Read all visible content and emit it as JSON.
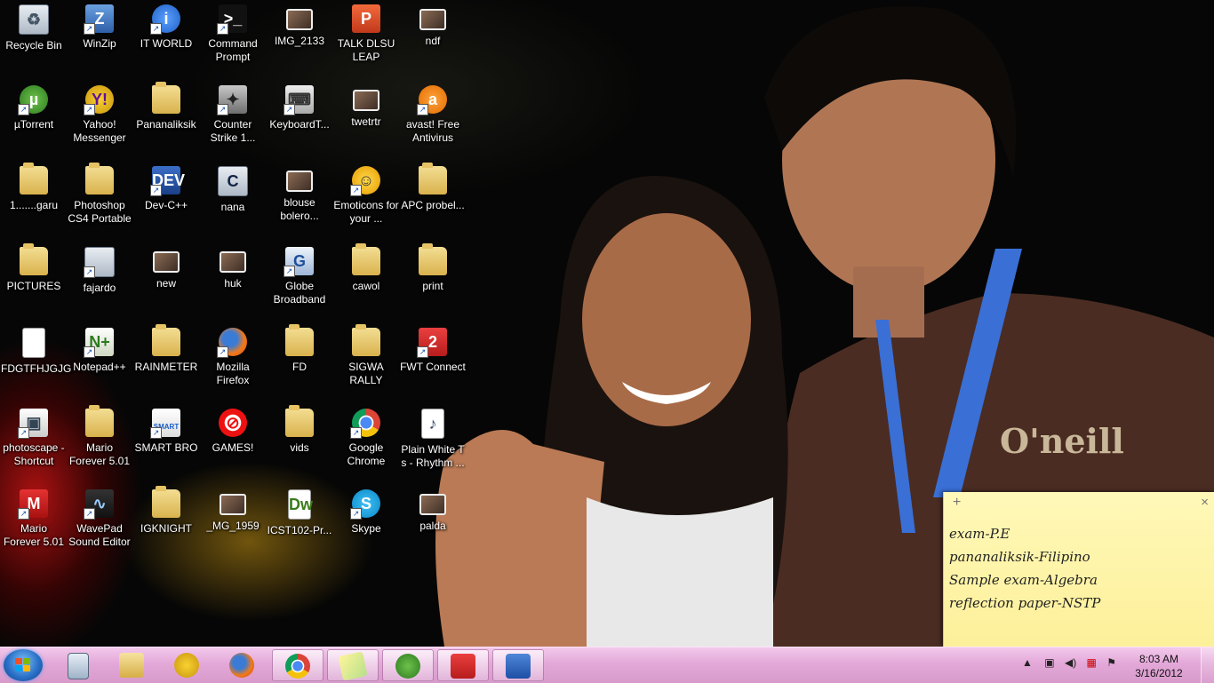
{
  "desktop_icons": [
    {
      "label": "Recycle Bin",
      "icon": "recycle-bin-icon"
    },
    {
      "label": "WinZip",
      "icon": "winzip-icon"
    },
    {
      "label": "IT WORLD",
      "icon": "info-icon"
    },
    {
      "label": "Command Prompt",
      "icon": "command-prompt-icon"
    },
    {
      "label": "IMG_2133",
      "icon": "image-file-icon"
    },
    {
      "label": "TALK DLSU LEAP",
      "icon": "powerpoint-icon"
    },
    {
      "label": "ndf",
      "icon": "image-file-icon"
    },
    {
      "label": "µTorrent",
      "icon": "utorrent-icon"
    },
    {
      "label": "Yahoo! Messenger",
      "icon": "yahoo-messenger-icon"
    },
    {
      "label": "Pananaliksik",
      "icon": "folder-icon"
    },
    {
      "label": "Counter Strike 1...",
      "icon": "counter-strike-icon"
    },
    {
      "label": "KeyboardT...",
      "icon": "keyboard-icon"
    },
    {
      "label": "twetrtr",
      "icon": "image-file-icon"
    },
    {
      "label": "avast! Free Antivirus",
      "icon": "avast-icon"
    },
    {
      "label": "1.......garu",
      "icon": "folder-icon"
    },
    {
      "label": "Photoshop CS4 Portable",
      "icon": "folder-icon"
    },
    {
      "label": "Dev-C++",
      "icon": "dev-cpp-icon"
    },
    {
      "label": "nana",
      "icon": "cpp-file-icon"
    },
    {
      "label": "blouse bolero...",
      "icon": "image-file-icon"
    },
    {
      "label": "Emoticons for your ...",
      "icon": "emoticon-icon"
    },
    {
      "label": "APC probel...",
      "icon": "folder-icon"
    },
    {
      "label": "PICTURES",
      "icon": "folder-icon"
    },
    {
      "label": "fajardo",
      "icon": "window-icon"
    },
    {
      "label": "new",
      "icon": "image-file-icon"
    },
    {
      "label": "huk",
      "icon": "image-file-icon"
    },
    {
      "label": "Globe Broadband",
      "icon": "globe-broadband-icon"
    },
    {
      "label": "cawol",
      "icon": "folder-icon"
    },
    {
      "label": "print",
      "icon": "folder-icon"
    },
    {
      "label": "FDGTFHJGJG",
      "icon": "text-file-icon"
    },
    {
      "label": "Notepad++",
      "icon": "notepad-plus-icon"
    },
    {
      "label": "RAINMETER",
      "icon": "folder-icon"
    },
    {
      "label": "Mozilla Firefox",
      "icon": "firefox-icon"
    },
    {
      "label": "FD",
      "icon": "folder-icon"
    },
    {
      "label": "SIGWA RALLY",
      "icon": "folder-icon"
    },
    {
      "label": "FWT Connect",
      "icon": "fwt-connect-icon"
    },
    {
      "label": "photoscape - Shortcut",
      "icon": "photoscape-icon"
    },
    {
      "label": "Mario Forever 5.01",
      "icon": "folder-icon"
    },
    {
      "label": "SMART BRO",
      "icon": "smart-bro-icon"
    },
    {
      "label": "GAMES!",
      "icon": "no-entry-icon"
    },
    {
      "label": "vids",
      "icon": "folder-icon"
    },
    {
      "label": "Google Chrome",
      "icon": "chrome-icon"
    },
    {
      "label": "Plain White T s - Rhythm ...",
      "icon": "mp3-file-icon"
    },
    {
      "label": "Mario Forever 5.01",
      "icon": "mario-icon"
    },
    {
      "label": "WavePad Sound Editor",
      "icon": "wavepad-icon"
    },
    {
      "label": "IGKNIGHT",
      "icon": "folder-icon"
    },
    {
      "label": "_MG_1959",
      "icon": "image-file-icon"
    },
    {
      "label": "ICST102-Pr...",
      "icon": "dreamweaver-file-icon"
    },
    {
      "label": "Skype",
      "icon": "skype-icon"
    },
    {
      "label": "palda",
      "icon": "image-file-icon"
    }
  ],
  "sticky_note": {
    "lines": [
      "exam-P.E",
      "pananaliksik-Filipino",
      "Sample exam-Algebra",
      "reflection paper-NSTP"
    ],
    "add_label": "+",
    "close_label": "×"
  },
  "taskbar": {
    "pinned": [
      {
        "name": "calculator-icon"
      },
      {
        "name": "windows-explorer-icon"
      },
      {
        "name": "yahoo-messenger-icon"
      },
      {
        "name": "firefox-icon"
      },
      {
        "name": "chrome-icon",
        "active": true
      },
      {
        "name": "sticky-notes-icon",
        "active": true
      },
      {
        "name": "utorrent-icon",
        "active": true
      },
      {
        "name": "fwt-connect-icon",
        "active": true
      },
      {
        "name": "word-icon",
        "active": true
      }
    ],
    "tray_icons": [
      "show-hidden-icons-icon",
      "usb-icon",
      "volume-icon",
      "network-error-icon",
      "action-center-icon"
    ],
    "clock": {
      "time": "8:03 AM",
      "date": "3/16/2012"
    },
    "colors": {
      "taskbar": "#e3a8d8"
    }
  }
}
